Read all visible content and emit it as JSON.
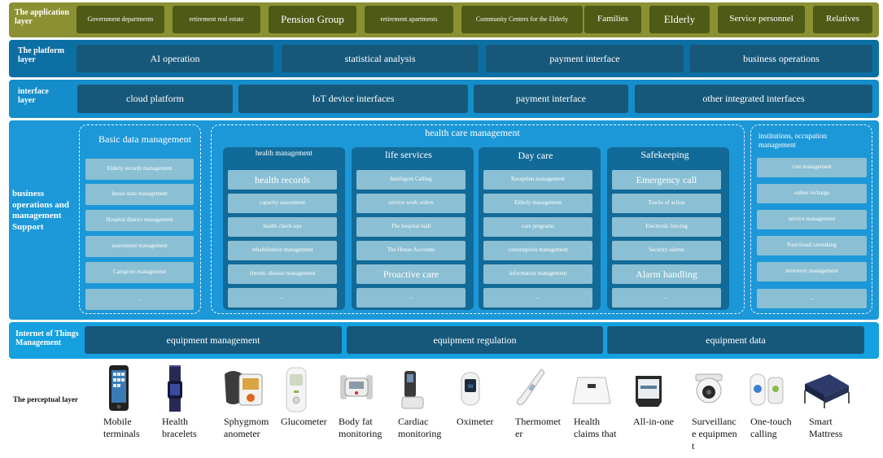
{
  "application_layer": {
    "label": "The application layer",
    "items": [
      "Government departments",
      "retirement real estate",
      "Pension Group",
      "retirement apartments",
      "Community Centers for the Elderly",
      "Families",
      "Elderly",
      "Service personnel",
      "Relatives"
    ]
  },
  "platform_layer": {
    "label": "The platform layer",
    "items": [
      "AI operation",
      "statistical analysis",
      "payment interface",
      "business operations"
    ]
  },
  "interface_layer": {
    "label": "interface layer",
    "items": [
      "cloud platform",
      "IoT device interfaces",
      "payment interface",
      "other integrated interfaces"
    ]
  },
  "business_support": {
    "label": "business operations and management Support",
    "basic_data": {
      "title": "Basic data management",
      "items": [
        "Elderly records management",
        "house state management",
        "Hospital district management",
        "assessment management",
        "Caregiver management",
        "..."
      ]
    },
    "health_care": {
      "title": "health care management",
      "columns": [
        {
          "title": "health management",
          "items": [
            "health records",
            "capacity assessment",
            "health check-ups",
            "rehabilitation management",
            "chronic disease management",
            "..."
          ]
        },
        {
          "title": "life services",
          "items": [
            "Intelligent Calling",
            "service work orders",
            "The hospital mall",
            "The House Accounts",
            "Proactive care",
            "..."
          ]
        },
        {
          "title": "Day care",
          "items": [
            "Reception management",
            "Elderly management",
            "care programs",
            "consumption management",
            "information management",
            "..."
          ]
        },
        {
          "title": "Safekeeping",
          "items": [
            "Emergency call",
            "Tracks of action",
            "Electronic fencing",
            "Security alarms",
            "Alarm handling",
            "..."
          ]
        }
      ]
    },
    "institutions": {
      "title": "institutions, occupation management",
      "items": [
        "cost management",
        "online recharge",
        "service management",
        "Functional caretaking",
        "inventory management",
        "..."
      ]
    }
  },
  "iot_management": {
    "label": "Internet of Things Management",
    "items": [
      "equipment management",
      "equipment regulation",
      "equipment data"
    ]
  },
  "perceptual_layer": {
    "label": "The perceptual layer",
    "devices": [
      {
        "label": "Mobile terminals",
        "icon": "mobile-terminal-icon"
      },
      {
        "label": "Health bracelets",
        "icon": "health-bracelet-icon"
      },
      {
        "label": "Sphygmomanometer",
        "icon": "sphygmomanometer-icon"
      },
      {
        "label": "Glucometer",
        "icon": "glucometer-icon"
      },
      {
        "label": "Body fat monitoring",
        "icon": "body-fat-monitor-icon"
      },
      {
        "label": "Cardiac monitoring",
        "icon": "cardiac-monitor-icon"
      },
      {
        "label": "Oximeter",
        "icon": "oximeter-icon"
      },
      {
        "label": "Thermometer",
        "icon": "thermometer-icon"
      },
      {
        "label": "Health claims that",
        "icon": "health-scale-icon"
      },
      {
        "label": "All-in-one",
        "icon": "all-in-one-icon"
      },
      {
        "label": "Surveillance equipment",
        "icon": "surveillance-camera-icon"
      },
      {
        "label": "One-touch calling",
        "icon": "one-touch-call-icon"
      },
      {
        "label": "Smart Mattress",
        "icon": "smart-mattress-icon"
      }
    ]
  },
  "colors": {
    "application_band": "#8b9133",
    "application_box": "#4f5a17",
    "platform_band": "#0c6fa3",
    "interface_band": "#158dca",
    "business_band": "#1c98d8",
    "iot_band": "#15a0e0",
    "dark_box": "#17587a",
    "light_box": "#8bbfd3"
  }
}
